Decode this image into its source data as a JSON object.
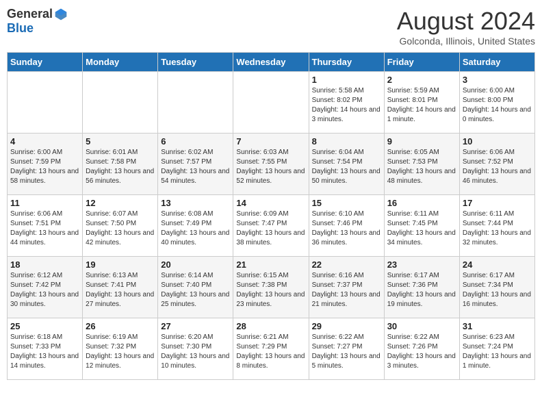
{
  "logo": {
    "general": "General",
    "blue": "Blue"
  },
  "title": {
    "month_year": "August 2024",
    "location": "Golconda, Illinois, United States"
  },
  "weekdays": [
    "Sunday",
    "Monday",
    "Tuesday",
    "Wednesday",
    "Thursday",
    "Friday",
    "Saturday"
  ],
  "weeks": [
    [
      {
        "day": "",
        "sunrise": "",
        "sunset": "",
        "daylight": ""
      },
      {
        "day": "",
        "sunrise": "",
        "sunset": "",
        "daylight": ""
      },
      {
        "day": "",
        "sunrise": "",
        "sunset": "",
        "daylight": ""
      },
      {
        "day": "",
        "sunrise": "",
        "sunset": "",
        "daylight": ""
      },
      {
        "day": "1",
        "sunrise": "Sunrise: 5:58 AM",
        "sunset": "Sunset: 8:02 PM",
        "daylight": "Daylight: 14 hours and 3 minutes."
      },
      {
        "day": "2",
        "sunrise": "Sunrise: 5:59 AM",
        "sunset": "Sunset: 8:01 PM",
        "daylight": "Daylight: 14 hours and 1 minute."
      },
      {
        "day": "3",
        "sunrise": "Sunrise: 6:00 AM",
        "sunset": "Sunset: 8:00 PM",
        "daylight": "Daylight: 14 hours and 0 minutes."
      }
    ],
    [
      {
        "day": "4",
        "sunrise": "Sunrise: 6:00 AM",
        "sunset": "Sunset: 7:59 PM",
        "daylight": "Daylight: 13 hours and 58 minutes."
      },
      {
        "day": "5",
        "sunrise": "Sunrise: 6:01 AM",
        "sunset": "Sunset: 7:58 PM",
        "daylight": "Daylight: 13 hours and 56 minutes."
      },
      {
        "day": "6",
        "sunrise": "Sunrise: 6:02 AM",
        "sunset": "Sunset: 7:57 PM",
        "daylight": "Daylight: 13 hours and 54 minutes."
      },
      {
        "day": "7",
        "sunrise": "Sunrise: 6:03 AM",
        "sunset": "Sunset: 7:55 PM",
        "daylight": "Daylight: 13 hours and 52 minutes."
      },
      {
        "day": "8",
        "sunrise": "Sunrise: 6:04 AM",
        "sunset": "Sunset: 7:54 PM",
        "daylight": "Daylight: 13 hours and 50 minutes."
      },
      {
        "day": "9",
        "sunrise": "Sunrise: 6:05 AM",
        "sunset": "Sunset: 7:53 PM",
        "daylight": "Daylight: 13 hours and 48 minutes."
      },
      {
        "day": "10",
        "sunrise": "Sunrise: 6:06 AM",
        "sunset": "Sunset: 7:52 PM",
        "daylight": "Daylight: 13 hours and 46 minutes."
      }
    ],
    [
      {
        "day": "11",
        "sunrise": "Sunrise: 6:06 AM",
        "sunset": "Sunset: 7:51 PM",
        "daylight": "Daylight: 13 hours and 44 minutes."
      },
      {
        "day": "12",
        "sunrise": "Sunrise: 6:07 AM",
        "sunset": "Sunset: 7:50 PM",
        "daylight": "Daylight: 13 hours and 42 minutes."
      },
      {
        "day": "13",
        "sunrise": "Sunrise: 6:08 AM",
        "sunset": "Sunset: 7:49 PM",
        "daylight": "Daylight: 13 hours and 40 minutes."
      },
      {
        "day": "14",
        "sunrise": "Sunrise: 6:09 AM",
        "sunset": "Sunset: 7:47 PM",
        "daylight": "Daylight: 13 hours and 38 minutes."
      },
      {
        "day": "15",
        "sunrise": "Sunrise: 6:10 AM",
        "sunset": "Sunset: 7:46 PM",
        "daylight": "Daylight: 13 hours and 36 minutes."
      },
      {
        "day": "16",
        "sunrise": "Sunrise: 6:11 AM",
        "sunset": "Sunset: 7:45 PM",
        "daylight": "Daylight: 13 hours and 34 minutes."
      },
      {
        "day": "17",
        "sunrise": "Sunrise: 6:11 AM",
        "sunset": "Sunset: 7:44 PM",
        "daylight": "Daylight: 13 hours and 32 minutes."
      }
    ],
    [
      {
        "day": "18",
        "sunrise": "Sunrise: 6:12 AM",
        "sunset": "Sunset: 7:42 PM",
        "daylight": "Daylight: 13 hours and 30 minutes."
      },
      {
        "day": "19",
        "sunrise": "Sunrise: 6:13 AM",
        "sunset": "Sunset: 7:41 PM",
        "daylight": "Daylight: 13 hours and 27 minutes."
      },
      {
        "day": "20",
        "sunrise": "Sunrise: 6:14 AM",
        "sunset": "Sunset: 7:40 PM",
        "daylight": "Daylight: 13 hours and 25 minutes."
      },
      {
        "day": "21",
        "sunrise": "Sunrise: 6:15 AM",
        "sunset": "Sunset: 7:38 PM",
        "daylight": "Daylight: 13 hours and 23 minutes."
      },
      {
        "day": "22",
        "sunrise": "Sunrise: 6:16 AM",
        "sunset": "Sunset: 7:37 PM",
        "daylight": "Daylight: 13 hours and 21 minutes."
      },
      {
        "day": "23",
        "sunrise": "Sunrise: 6:17 AM",
        "sunset": "Sunset: 7:36 PM",
        "daylight": "Daylight: 13 hours and 19 minutes."
      },
      {
        "day": "24",
        "sunrise": "Sunrise: 6:17 AM",
        "sunset": "Sunset: 7:34 PM",
        "daylight": "Daylight: 13 hours and 16 minutes."
      }
    ],
    [
      {
        "day": "25",
        "sunrise": "Sunrise: 6:18 AM",
        "sunset": "Sunset: 7:33 PM",
        "daylight": "Daylight: 13 hours and 14 minutes."
      },
      {
        "day": "26",
        "sunrise": "Sunrise: 6:19 AM",
        "sunset": "Sunset: 7:32 PM",
        "daylight": "Daylight: 13 hours and 12 minutes."
      },
      {
        "day": "27",
        "sunrise": "Sunrise: 6:20 AM",
        "sunset": "Sunset: 7:30 PM",
        "daylight": "Daylight: 13 hours and 10 minutes."
      },
      {
        "day": "28",
        "sunrise": "Sunrise: 6:21 AM",
        "sunset": "Sunset: 7:29 PM",
        "daylight": "Daylight: 13 hours and 8 minutes."
      },
      {
        "day": "29",
        "sunrise": "Sunrise: 6:22 AM",
        "sunset": "Sunset: 7:27 PM",
        "daylight": "Daylight: 13 hours and 5 minutes."
      },
      {
        "day": "30",
        "sunrise": "Sunrise: 6:22 AM",
        "sunset": "Sunset: 7:26 PM",
        "daylight": "Daylight: 13 hours and 3 minutes."
      },
      {
        "day": "31",
        "sunrise": "Sunrise: 6:23 AM",
        "sunset": "Sunset: 7:24 PM",
        "daylight": "Daylight: 13 hours and 1 minute."
      }
    ]
  ]
}
